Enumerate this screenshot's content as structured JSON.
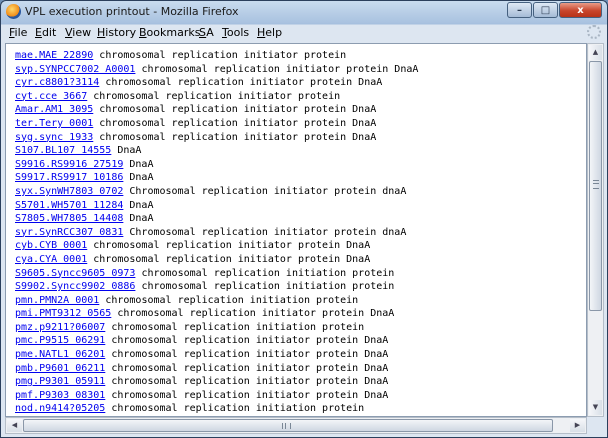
{
  "window": {
    "title": "VPL execution printout - Mozilla Firefox"
  },
  "menu": [
    "File",
    "Edit",
    "View",
    "History",
    "Bookmarks",
    "SA",
    "Tools",
    "Help"
  ],
  "window_buttons": {
    "minimize": "–",
    "maximize": "□",
    "close": "x"
  },
  "scroll_arrows": {
    "up": "▲",
    "down": "▼",
    "left": "◀",
    "right": "▶"
  },
  "entries": [
    {
      "id": "mae.MAE 22890",
      "desc": " chromosomal replication initiator protein"
    },
    {
      "id": "syp.SYNPCC7002 A0001",
      "desc": " chromosomal replication initiator protein DnaA"
    },
    {
      "id": "cyr.c8801?3114",
      "desc": " chromosomal replication initiator protein DnaA"
    },
    {
      "id": "cyt.cce 3667",
      "desc": " chromosomal replication initiator protein"
    },
    {
      "id": "Amar.AM1 3095",
      "desc": " chromosomal replication initiator protein DnaA"
    },
    {
      "id": "ter.Tery 0001",
      "desc": " chromosomal replication initiator protein DnaA"
    },
    {
      "id": "syg.sync 1933",
      "desc": " chromosomal replication initiator protein DnaA"
    },
    {
      "id": "S107.BL107 14555",
      "desc": " DnaA"
    },
    {
      "id": "S9916.RS9916 27519",
      "desc": " DnaA"
    },
    {
      "id": "S9917.RS9917 10186",
      "desc": " DnaA"
    },
    {
      "id": "syx.SynWH7803 0702",
      "desc": " Chromosomal replication initiator protein dnaA"
    },
    {
      "id": "S5701.WH5701 11284",
      "desc": " DnaA"
    },
    {
      "id": "S7805.WH7805 14408",
      "desc": " DnaA"
    },
    {
      "id": "syr.SynRCC307 0831",
      "desc": " Chromosomal replication initiator protein dnaA"
    },
    {
      "id": "cyb.CYB 0001",
      "desc": " chromosomal replication initiator protein DnaA"
    },
    {
      "id": "cya.CYA 0001",
      "desc": " chromosomal replication initiator protein DnaA"
    },
    {
      "id": "S9605.Syncc9605 0973",
      "desc": " chromosomal replication initiation protein"
    },
    {
      "id": "S9902.Syncc9902 0886",
      "desc": " chromosomal replication initiation protein"
    },
    {
      "id": "pmn.PMN2A 0001",
      "desc": " chromosomal replication initiation protein"
    },
    {
      "id": "pmi.PMT9312 0565",
      "desc": " chromosomal replication initiator protein DnaA"
    },
    {
      "id": "pmz.p9211?06007",
      "desc": " chromosomal replication initiation protein"
    },
    {
      "id": "pmc.P9515 06291",
      "desc": " chromosomal replication initiator protein DnaA"
    },
    {
      "id": "pme.NATL1 06201",
      "desc": " chromosomal replication initiator protein DnaA"
    },
    {
      "id": "pmb.P9601 06211",
      "desc": " chromosomal replication initiator protein DnaA"
    },
    {
      "id": "pmg.P9301 05911",
      "desc": " chromosomal replication initiator protein DnaA"
    },
    {
      "id": "pmf.P9303 08301",
      "desc": " chromosomal replication initiator protein DnaA"
    },
    {
      "id": "nod.n9414?05205",
      "desc": " chromosomal replication initiation protein"
    }
  ]
}
